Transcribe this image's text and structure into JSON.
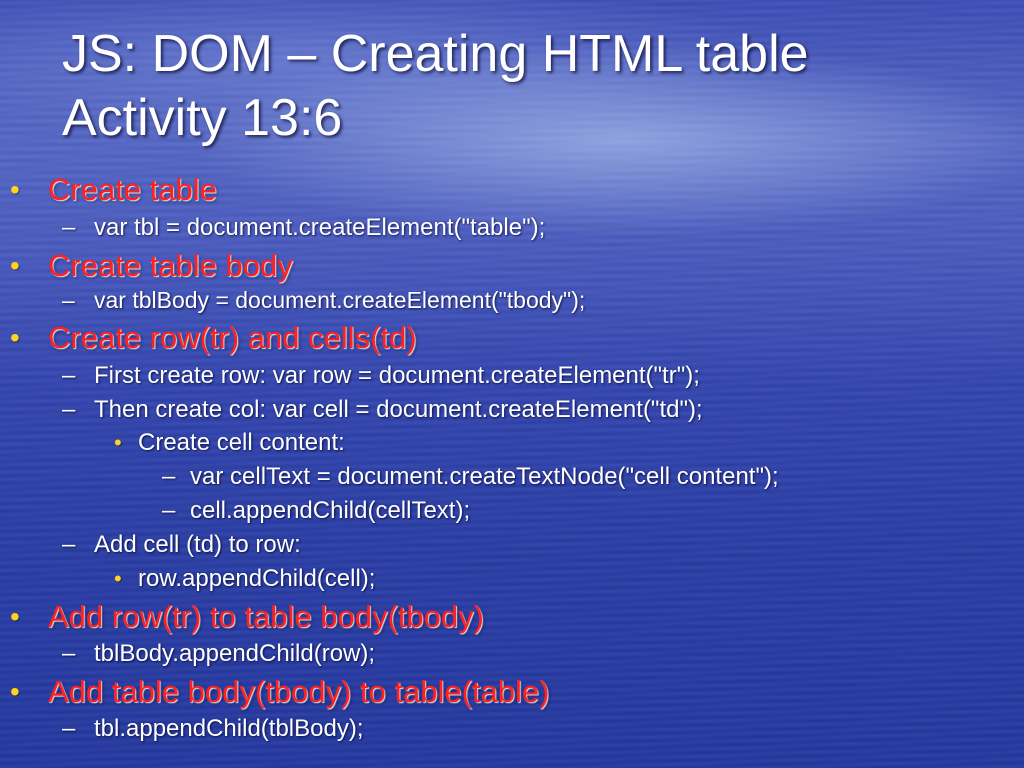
{
  "slide": {
    "title_line1": "JS: DOM – Creating HTML table",
    "title_line2": "Activity 13:6",
    "bullet_glyph": "•",
    "dash_glyph": "–",
    "colors": {
      "heading_bullet_text": "#ff2020",
      "bullet_marker": "#ffd21f",
      "body_text": "#ffffff"
    },
    "items": [
      {
        "level": 1,
        "text": "Create table"
      },
      {
        "level": 2,
        "text": "var tbl  = document.createElement(\"table\");"
      },
      {
        "level": 1,
        "text": "Create table body"
      },
      {
        "level": 2,
        "text": "var tblBody = document.createElement(\"tbody\");"
      },
      {
        "level": 1,
        "text": "Create row(tr) and cells(td)"
      },
      {
        "level": 2,
        "text": "First create row: var row = document.createElement(\"tr\");"
      },
      {
        "level": 2,
        "text": "Then create col: var cell = document.createElement(\"td\");"
      },
      {
        "level": 3,
        "text": "Create cell content:"
      },
      {
        "level": 4,
        "text": "var cellText = document.createTextNode(\"cell content\");"
      },
      {
        "level": 4,
        "text": "cell.appendChild(cellText);"
      },
      {
        "level": 2,
        "text": "Add cell (td) to row:"
      },
      {
        "level": 3,
        "text": "row.appendChild(cell);"
      },
      {
        "level": 1,
        "text": "Add row(tr) to table body(tbody)"
      },
      {
        "level": 2,
        "text": "tblBody.appendChild(row);"
      },
      {
        "level": 1,
        "text": "Add table body(tbody) to table(table)"
      },
      {
        "level": 2,
        "text": "tbl.appendChild(tblBody);"
      }
    ]
  }
}
